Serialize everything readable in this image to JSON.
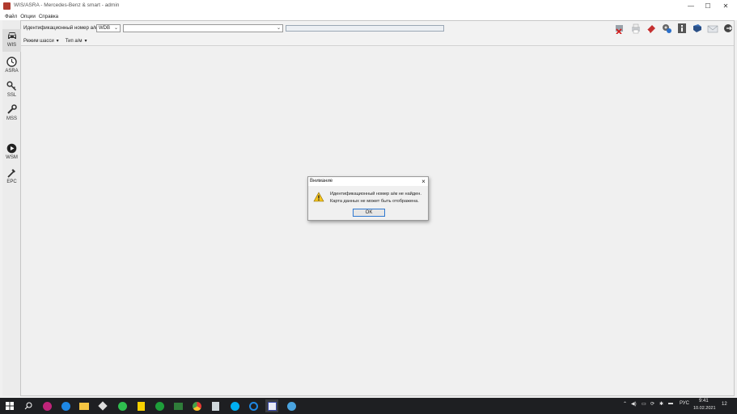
{
  "window": {
    "title": "WIS/ASRA - Mercedes-Benz & smart - admin",
    "minimize": "—",
    "maximize": "☐",
    "close": "✕"
  },
  "menu": [
    "Файл",
    "Опции",
    "Справка"
  ],
  "sidebar": [
    {
      "label": "WIS",
      "icon": "car-icon"
    },
    {
      "label": "ASRA",
      "icon": "clock-icon"
    },
    {
      "label": "SSL",
      "icon": "key-icon"
    },
    {
      "label": "MSS",
      "icon": "wrench-icon"
    },
    {
      "label": "WSM",
      "icon": "play-icon"
    },
    {
      "label": "EPC",
      "icon": "tool-icon"
    }
  ],
  "toolbar": {
    "vin_label": "Идентификационный номер а/м",
    "vin_prefix": "WDB",
    "vin_value": ""
  },
  "subbar": {
    "chassis_mode": "Режим шасси",
    "vehicle_type": "Тип а/м"
  },
  "dialog": {
    "title": "Внимание",
    "line1": "Идентификационный номер а/м не найден.",
    "line2": "Карта данных не может быть отображена.",
    "ok": "OK"
  },
  "taskbar": {
    "lang": "РУС",
    "time": "9:41",
    "date": "10.02.2021",
    "notifications": "12"
  }
}
